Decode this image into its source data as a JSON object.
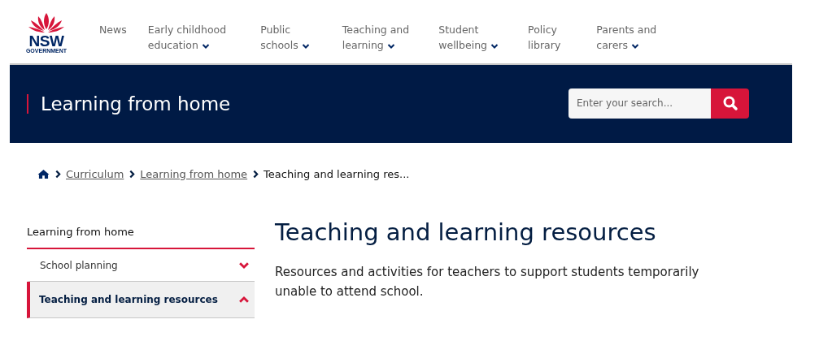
{
  "logo": {
    "name": "NSW",
    "subtitle": "GOVERNMENT"
  },
  "nav": [
    {
      "label": "News",
      "dropdown": false
    },
    {
      "label": "Early childhood\neducation",
      "dropdown": true
    },
    {
      "label": "Public\nschools",
      "dropdown": true
    },
    {
      "label": "Teaching and\nlearning",
      "dropdown": true
    },
    {
      "label": "Student\nwellbeing",
      "dropdown": true
    },
    {
      "label": "Policy\nlibrary",
      "dropdown": false
    },
    {
      "label": "Parents and\ncarers",
      "dropdown": true
    }
  ],
  "banner": {
    "title": "Learning from home",
    "search": {
      "placeholder": "Enter your search..."
    }
  },
  "breadcrumb": [
    {
      "label": "Curriculum",
      "link": true
    },
    {
      "label": "Learning from home",
      "link": true
    },
    {
      "label": "Teaching and learning res...",
      "link": false
    }
  ],
  "sidebar": {
    "title": "Learning from home",
    "items": [
      {
        "label": "School planning",
        "selected": false,
        "expanded": false
      },
      {
        "label": "Teaching and learning resources",
        "selected": true,
        "expanded": true
      }
    ]
  },
  "main": {
    "heading": "Teaching and learning resources",
    "intro": "Resources and activities for teachers to support students temporarily unable to attend school."
  }
}
